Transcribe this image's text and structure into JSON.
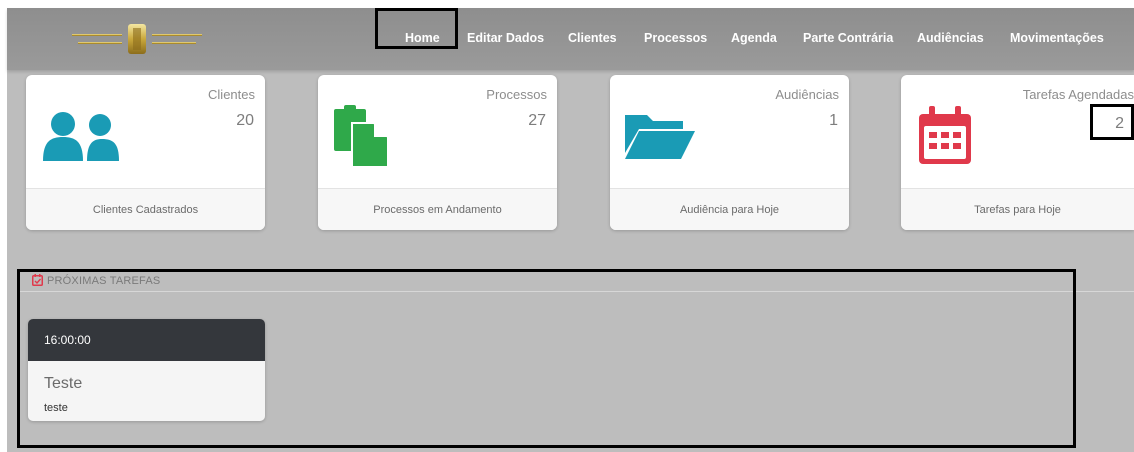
{
  "nav": {
    "items": [
      "Home",
      "Editar Dados",
      "Clientes",
      "Processos",
      "Agenda",
      "Parte Contrária",
      "Audiências",
      "Movimentações"
    ],
    "active": "Home"
  },
  "cards": [
    {
      "label": "Clientes",
      "value": "20",
      "footer": "Clientes Cadastrados",
      "icon": "users-icon",
      "color": "#1a9bb5"
    },
    {
      "label": "Processos",
      "value": "27",
      "footer": "Processos em Andamento",
      "icon": "copy-documents-icon",
      "color": "#2fa94a"
    },
    {
      "label": "Audiências",
      "value": "1",
      "footer": "Audiência para Hoje",
      "icon": "folder-open-icon",
      "color": "#1a9bb5"
    },
    {
      "label": "Tarefas Agendadas",
      "value": "2",
      "footer": "Tarefas para Hoje",
      "icon": "calendar-icon",
      "color": "#e0394b"
    }
  ],
  "tasks_section": {
    "title": "PRÓXIMAS TAREFAS",
    "icon": "calendar-check-icon",
    "tasks": [
      {
        "time": "16:00:00",
        "title": "Teste",
        "description": "teste"
      }
    ]
  },
  "colors": {
    "navbar": "#919191",
    "page_background": "#bdbdbd",
    "task_header": "#34373c"
  }
}
